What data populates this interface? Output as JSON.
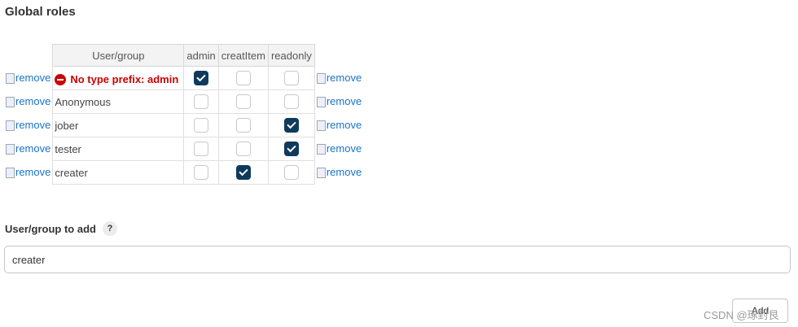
{
  "title": "Global roles",
  "table": {
    "header": {
      "user_group": "User/group",
      "columns": [
        "admin",
        "creatItem",
        "readonly"
      ]
    },
    "remove_label": "remove",
    "rows": [
      {
        "name": "No type prefix: admin",
        "error": true,
        "checks": [
          true,
          false,
          false
        ]
      },
      {
        "name": "Anonymous",
        "error": false,
        "checks": [
          false,
          false,
          false
        ]
      },
      {
        "name": "jober",
        "error": false,
        "checks": [
          false,
          false,
          true
        ]
      },
      {
        "name": "tester",
        "error": false,
        "checks": [
          false,
          false,
          true
        ]
      },
      {
        "name": "creater",
        "error": false,
        "checks": [
          false,
          true,
          false
        ]
      }
    ]
  },
  "add": {
    "label": "User/group to add",
    "help": "?",
    "value": "creater",
    "button_label": "Add"
  },
  "watermark": "CSDN @琢封艮"
}
